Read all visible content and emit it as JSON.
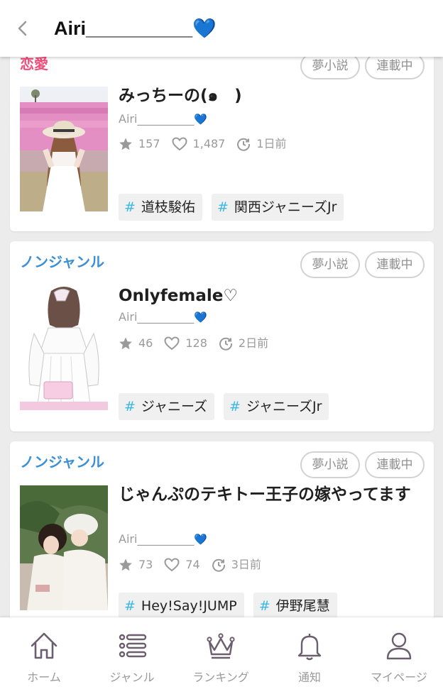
{
  "header": {
    "title": "Airi__________💙"
  },
  "colors": {
    "romance": "#ef4c7a",
    "nongenre": "#3a8fd7",
    "accent": "#3ab8e3",
    "nav_icon": "#6b5e6e"
  },
  "stories": [
    {
      "genre": "恋愛",
      "badges": [
        "夢小説",
        "連載中"
      ],
      "title": "みっちーの(๑　)",
      "author": "Airi__________",
      "stars": "157",
      "likes": "1,487",
      "updated": "1日前",
      "tags": [
        "道枝駿佑",
        "関西ジャニーズJr"
      ]
    },
    {
      "genre": "ノンジャンル",
      "badges": [
        "夢小説",
        "連載中"
      ],
      "title": "Onlyfemale♡",
      "author": "Airi__________",
      "stars": "46",
      "likes": "128",
      "updated": "2日前",
      "tags": [
        "ジャニーズ",
        "ジャニーズJr"
      ]
    },
    {
      "genre": "ノンジャンル",
      "badges": [
        "夢小説",
        "連載中"
      ],
      "title": "じゃんぷのテキトー王子の嫁やってます",
      "author": "Airi__________",
      "stars": "73",
      "likes": "74",
      "updated": "3日前",
      "tags": [
        "Hey!Say!JUMP",
        "伊野尾慧"
      ]
    }
  ],
  "nav": [
    {
      "label": "ホーム",
      "icon": "home-icon"
    },
    {
      "label": "ジャンル",
      "icon": "list-icon"
    },
    {
      "label": "ランキング",
      "icon": "crown-icon"
    },
    {
      "label": "通知",
      "icon": "bell-icon"
    },
    {
      "label": "マイページ",
      "icon": "user-icon"
    }
  ]
}
